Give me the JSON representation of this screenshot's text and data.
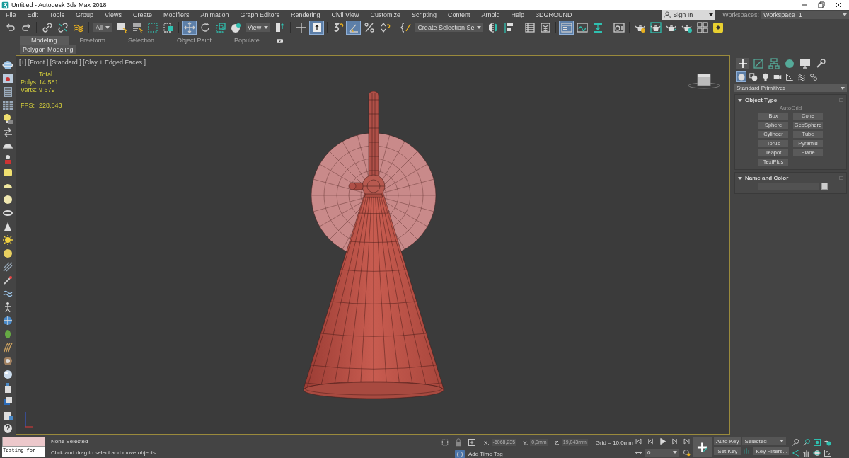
{
  "title_bar": {
    "title": "Untitled - Autodesk 3ds Max 2018"
  },
  "menu_bar": {
    "items": [
      "File",
      "Edit",
      "Tools",
      "Group",
      "Views",
      "Create",
      "Modifiers",
      "Animation",
      "Graph Editors",
      "Rendering",
      "Civil View",
      "Customize",
      "Scripting",
      "Content",
      "Arnold",
      "Help",
      "3DGROUND"
    ]
  },
  "account": {
    "sign_in": "Sign In",
    "workspaces_label": "Workspaces:",
    "workspace": "Workspace_1"
  },
  "main_toolbar": [
    {
      "kind": "button",
      "selected": false
    },
    {
      "kind": "button",
      "selected": false
    },
    {
      "kind": "separator"
    },
    {
      "kind": "button",
      "selected": false
    },
    {
      "kind": "button",
      "selected": false
    },
    {
      "kind": "button",
      "selected": false
    },
    {
      "kind": "separator"
    },
    {
      "kind": "dropdown",
      "value": "All"
    },
    {
      "kind": "button",
      "selected": false
    },
    {
      "kind": "button",
      "selected": false
    },
    {
      "kind": "button",
      "selected": false
    },
    {
      "kind": "button",
      "selected": false
    },
    {
      "kind": "separator"
    },
    {
      "kind": "button",
      "selected": true
    },
    {
      "kind": "button",
      "selected": false
    },
    {
      "kind": "button",
      "selected": false
    },
    {
      "kind": "button",
      "selected": false
    },
    {
      "kind": "dropdown",
      "value": "View"
    },
    {
      "kind": "button",
      "selected": false
    },
    {
      "kind": "separator"
    },
    {
      "kind": "button",
      "selected": false
    },
    {
      "kind": "button",
      "selected": true
    },
    {
      "kind": "separator"
    },
    {
      "kind": "button",
      "selected": false
    },
    {
      "kind": "button",
      "selected": true
    },
    {
      "kind": "button",
      "selected": false
    },
    {
      "kind": "button",
      "selected": false
    },
    {
      "kind": "separator"
    },
    {
      "kind": "button",
      "selected": false
    },
    {
      "kind": "dropdown",
      "value": "Create Selection Se"
    },
    {
      "kind": "button",
      "selected": false
    },
    {
      "kind": "button",
      "selected": false
    },
    {
      "kind": "separator"
    },
    {
      "kind": "button",
      "selected": false
    },
    {
      "kind": "button",
      "selected": false
    },
    {
      "kind": "separator"
    },
    {
      "kind": "button",
      "selected": true
    },
    {
      "kind": "button",
      "selected": false
    },
    {
      "kind": "button",
      "selected": false
    },
    {
      "kind": "separator"
    },
    {
      "kind": "button",
      "selected": false
    },
    {
      "kind": "separator"
    },
    {
      "kind": "button",
      "selected": false
    },
    {
      "kind": "button",
      "selected": false
    },
    {
      "kind": "button",
      "selected": false
    },
    {
      "kind": "button",
      "selected": false
    },
    {
      "kind": "button",
      "selected": false
    },
    {
      "kind": "button",
      "selected": false
    }
  ],
  "ribbon": {
    "tabs": [
      {
        "label": "Modeling",
        "selected": true
      },
      {
        "label": "Freeform",
        "selected": false
      },
      {
        "label": "Selection",
        "selected": false
      },
      {
        "label": "Object Paint",
        "selected": false
      },
      {
        "label": "Populate",
        "selected": false
      }
    ],
    "panel_label": "Polygon Modeling"
  },
  "viewport": {
    "label": "[+] [Front ] [Standard ] [Clay + Edged Faces ]",
    "stats": {
      "heading": "Total",
      "rows": [
        {
          "label": "Polys:",
          "value": "14 581"
        },
        {
          "label": "Verts:",
          "value": "9 679"
        }
      ],
      "fps_label": "FPS:",
      "fps": "228,843"
    }
  },
  "command_panel": {
    "tabs": [
      {
        "selected": true
      },
      {
        "selected": false
      },
      {
        "selected": false
      },
      {
        "selected": false
      },
      {
        "selected": false
      },
      {
        "selected": false
      }
    ],
    "categories": [
      {
        "selected": true
      },
      {
        "selected": false
      },
      {
        "selected": false
      },
      {
        "selected": false
      },
      {
        "selected": false
      },
      {
        "selected": false
      },
      {
        "selected": false
      }
    ],
    "dropdown": "Standard Primitives",
    "object_type": {
      "title": "Object Type",
      "autogrid": {
        "label": "AutoGrid",
        "disabled": true
      },
      "buttons": [
        "Box",
        "Cone",
        "Sphere",
        "GeoSphere",
        "Cylinder",
        "Tube",
        "Torus",
        "Pyramid",
        "Teapot",
        "Plane",
        "TextPlus"
      ]
    },
    "name_and_color": {
      "title": "Name and Color"
    }
  },
  "status_bar": {
    "listener_output": "Testing for :",
    "selection": "None Selected",
    "prompt": "Click and drag to select and move objects",
    "coords": [
      {
        "axis": "X:",
        "value": "-6068,235",
        "disabled": true
      },
      {
        "axis": "Y:",
        "value": "0,0mm",
        "disabled": true
      },
      {
        "axis": "Z:",
        "value": "19,043mm",
        "disabled": true
      }
    ],
    "grid": "Grid = 10,0mm",
    "time_tag": "Add Time Tag",
    "frame": "0",
    "auto_key": "Auto Key",
    "key_mode": "Selected",
    "set_key": "Set Key",
    "key_filters": "Key Filters..."
  }
}
